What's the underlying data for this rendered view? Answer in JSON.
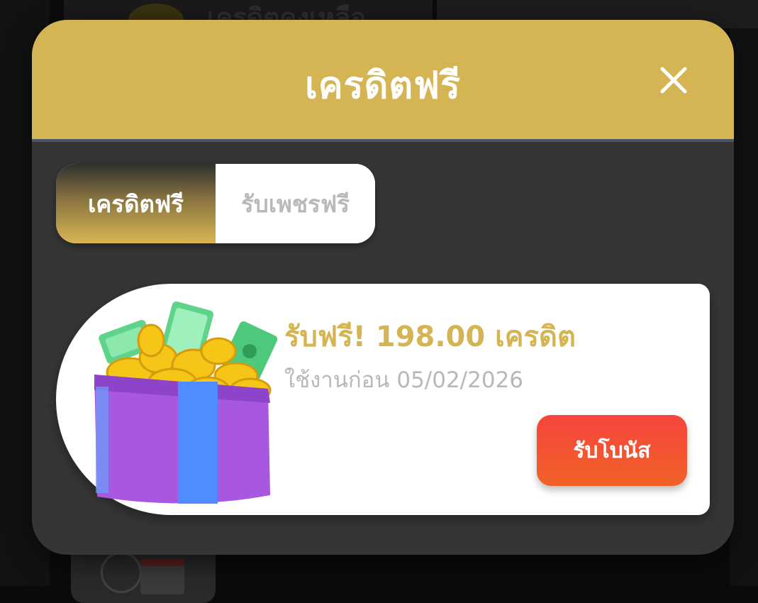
{
  "background": {
    "label": "เครดิตคงเหลือ"
  },
  "modal": {
    "title": "เครดิตฟรี",
    "close_icon": "close-icon",
    "tabs": [
      {
        "label": "เครดิตฟรี",
        "active": true
      },
      {
        "label": "รับเพชรฟรี",
        "active": false
      }
    ],
    "bonus": {
      "title": "รับฟรี! 198.00 เครดิต",
      "expiry": "ใช้งานก่อน 05/02/2026",
      "claim_label": "รับโบนัส",
      "icon": "gift-box-icon"
    }
  },
  "colors": {
    "accent_gold": "#d5b553",
    "modal_bg": "#353535",
    "claim_button": "#f24a35",
    "inactive_tab_text": "#b9b9b9"
  }
}
